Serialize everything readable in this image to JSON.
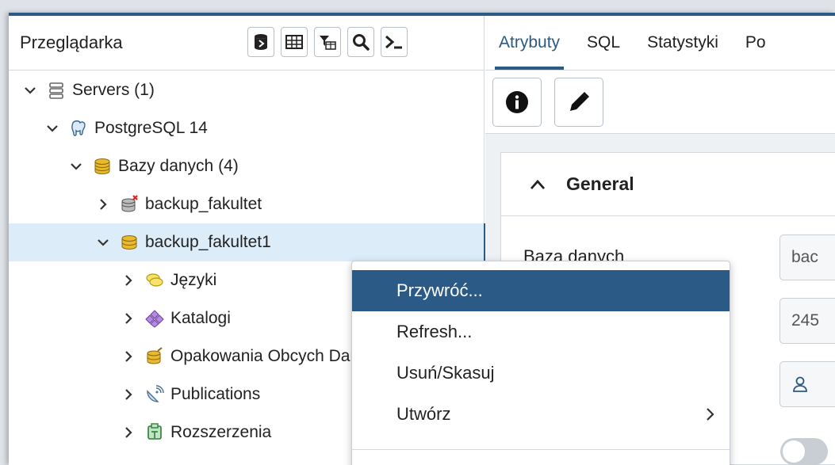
{
  "browser": {
    "title": "Przeglądarka",
    "toolbar": [
      "database-icon",
      "grid-icon",
      "filter-table-icon",
      "search-icon",
      "terminal-icon"
    ]
  },
  "tree": [
    {
      "label": "Servers (1)",
      "expanded": true,
      "level": 0,
      "icon": "servers-icon"
    },
    {
      "label": "PostgreSQL 14",
      "expanded": true,
      "level": 1,
      "icon": "elephant-icon"
    },
    {
      "label": "Bazy danych (4)",
      "expanded": true,
      "level": 2,
      "icon": "databases-icon"
    },
    {
      "label": "backup_fakultet",
      "expanded": false,
      "level": 3,
      "icon": "database-disconnected-icon"
    },
    {
      "label": "backup_fakultet1",
      "expanded": true,
      "level": 3,
      "icon": "database-icon",
      "selected": true
    },
    {
      "label": "Języki",
      "expanded": false,
      "level": 4,
      "icon": "languages-icon"
    },
    {
      "label": "Katalogi",
      "expanded": false,
      "level": 4,
      "icon": "catalogs-icon"
    },
    {
      "label": "Opakowania Obcych Danych",
      "expanded": false,
      "level": 4,
      "icon": "fdw-icon"
    },
    {
      "label": "Publications",
      "expanded": false,
      "level": 4,
      "icon": "publications-icon"
    },
    {
      "label": "Rozszerzenia",
      "expanded": false,
      "level": 4,
      "icon": "extensions-icon"
    }
  ],
  "tabs": [
    "Atrybuty",
    "SQL",
    "Statystyki",
    "Po"
  ],
  "active_tab": "Atrybuty",
  "properties": {
    "section_title": "General",
    "database_label": "Baza danych",
    "database_value": "bac",
    "oid_value": "245"
  },
  "context_menu": {
    "items": [
      {
        "label": "Przywróć...",
        "active": true
      },
      {
        "label": "Refresh...",
        "active": false
      },
      {
        "label": "Usuń/Skasuj",
        "active": false
      },
      {
        "label": "Utwórz",
        "active": false,
        "submenu": true
      }
    ]
  },
  "colors": {
    "accent": "#2b5a86",
    "selected_row": "#dcedf9",
    "database_icon": "#e9b92e"
  }
}
